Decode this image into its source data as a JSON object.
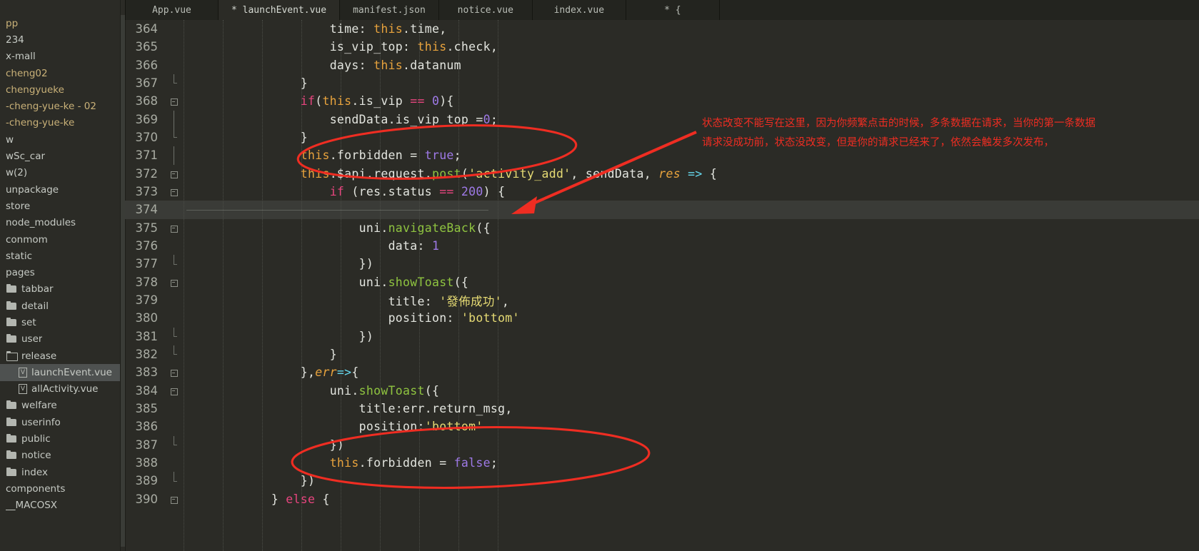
{
  "window": {
    "background": "#2b2b26",
    "annotation_color": "#ef2d22"
  },
  "sidebar": {
    "items": [
      {
        "label": "pp",
        "icon": "none",
        "color": "amber",
        "indent": 0,
        "selected": false
      },
      {
        "label": "234",
        "icon": "none",
        "color": "ltgray",
        "indent": 0,
        "selected": false
      },
      {
        "label": "x-mall",
        "icon": "none",
        "color": "ltgray",
        "indent": 0,
        "selected": false
      },
      {
        "label": "cheng02",
        "icon": "none",
        "color": "amber",
        "indent": 0,
        "selected": false
      },
      {
        "label": "chengyueke",
        "icon": "none",
        "color": "amber",
        "indent": 0,
        "selected": false
      },
      {
        "label": "-cheng-yue-ke - 02",
        "icon": "none",
        "color": "amber",
        "indent": 0,
        "selected": false
      },
      {
        "label": "-cheng-yue-ke",
        "icon": "none",
        "color": "amber",
        "indent": 0,
        "selected": false
      },
      {
        "label": "w",
        "icon": "none",
        "color": "ltgray",
        "indent": 0,
        "selected": false
      },
      {
        "label": "wSc_car",
        "icon": "none",
        "color": "ltgray",
        "indent": 0,
        "selected": false
      },
      {
        "label": "w(2)",
        "icon": "none",
        "color": "ltgray",
        "indent": 0,
        "selected": false
      },
      {
        "label": "unpackage",
        "icon": "none",
        "color": "ltgray",
        "indent": 0,
        "selected": false
      },
      {
        "label": "store",
        "icon": "none",
        "color": "ltgray",
        "indent": 0,
        "selected": false
      },
      {
        "label": "node_modules",
        "icon": "none",
        "color": "ltgray",
        "indent": 0,
        "selected": false
      },
      {
        "label": "conmom",
        "icon": "none",
        "color": "ltgray",
        "indent": 0,
        "selected": false
      },
      {
        "label": "static",
        "icon": "none",
        "color": "ltgray",
        "indent": 0,
        "selected": false
      },
      {
        "label": "pages",
        "icon": "none",
        "color": "ltgray",
        "indent": 0,
        "selected": false
      },
      {
        "label": "tabbar",
        "icon": "folder",
        "color": "ltgray",
        "indent": 0,
        "selected": false
      },
      {
        "label": "detail",
        "icon": "folder",
        "color": "ltgray",
        "indent": 0,
        "selected": false
      },
      {
        "label": "set",
        "icon": "folder",
        "color": "ltgray",
        "indent": 0,
        "selected": false
      },
      {
        "label": "user",
        "icon": "folder",
        "color": "ltgray",
        "indent": 0,
        "selected": false
      },
      {
        "label": "release",
        "icon": "folder-open",
        "color": "ltgray",
        "indent": 0,
        "selected": false
      },
      {
        "label": "launchEvent.vue",
        "icon": "vue-file",
        "color": "ltgray",
        "indent": 1,
        "selected": true
      },
      {
        "label": "allActivity.vue",
        "icon": "vue-file",
        "color": "ltgray",
        "indent": 1,
        "selected": false
      },
      {
        "label": "welfare",
        "icon": "folder",
        "color": "ltgray",
        "indent": 0,
        "selected": false
      },
      {
        "label": "userinfo",
        "icon": "folder",
        "color": "ltgray",
        "indent": 0,
        "selected": false
      },
      {
        "label": "public",
        "icon": "folder",
        "color": "ltgray",
        "indent": 0,
        "selected": false
      },
      {
        "label": "notice",
        "icon": "folder",
        "color": "ltgray",
        "indent": 0,
        "selected": false
      },
      {
        "label": "index",
        "icon": "folder",
        "color": "ltgray",
        "indent": 0,
        "selected": false
      },
      {
        "label": "components",
        "icon": "none",
        "color": "ltgray",
        "indent": 0,
        "selected": false
      },
      {
        "label": "__MACOSX",
        "icon": "none",
        "color": "ltgray",
        "indent": 0,
        "selected": false
      }
    ]
  },
  "tabs": [
    {
      "label": "App.vue",
      "active": false,
      "modified": false
    },
    {
      "label": "* launchEvent.vue",
      "active": true,
      "modified": true
    },
    {
      "label": "manifest.json",
      "active": false,
      "modified": false
    },
    {
      "label": "notice.vue",
      "active": false,
      "modified": false
    },
    {
      "label": "index.vue",
      "active": false,
      "modified": false
    },
    {
      "label": "* {",
      "active": false,
      "modified": true
    }
  ],
  "editor": {
    "first_line": 364,
    "current_line": 374,
    "lines": [
      {
        "num": "364",
        "fold": "none",
        "current": false,
        "tokens": [
          {
            "t": "                    ",
            "c": "plain"
          },
          {
            "t": "time",
            "c": "prop"
          },
          {
            "t": ": ",
            "c": "punct"
          },
          {
            "t": "this",
            "c": "this"
          },
          {
            "t": ".",
            "c": "punct"
          },
          {
            "t": "time",
            "c": "plain"
          },
          {
            "t": ",",
            "c": "punct"
          }
        ]
      },
      {
        "num": "365",
        "fold": "none",
        "current": false,
        "tokens": [
          {
            "t": "                    ",
            "c": "plain"
          },
          {
            "t": "is_vip_top",
            "c": "prop"
          },
          {
            "t": ": ",
            "c": "punct"
          },
          {
            "t": "this",
            "c": "this"
          },
          {
            "t": ".",
            "c": "punct"
          },
          {
            "t": "check",
            "c": "plain"
          },
          {
            "t": ",",
            "c": "punct"
          }
        ]
      },
      {
        "num": "366",
        "fold": "none",
        "current": false,
        "tokens": [
          {
            "t": "                    ",
            "c": "plain"
          },
          {
            "t": "days",
            "c": "prop"
          },
          {
            "t": ": ",
            "c": "punct"
          },
          {
            "t": "this",
            "c": "this"
          },
          {
            "t": ".",
            "c": "punct"
          },
          {
            "t": "datanum",
            "c": "plain"
          }
        ]
      },
      {
        "num": "367",
        "fold": "barend",
        "current": false,
        "tokens": [
          {
            "t": "                ",
            "c": "plain"
          },
          {
            "t": "}",
            "c": "punct"
          }
        ]
      },
      {
        "num": "368",
        "fold": "box",
        "current": false,
        "tokens": [
          {
            "t": "                ",
            "c": "plain"
          },
          {
            "t": "if",
            "c": "key"
          },
          {
            "t": "(",
            "c": "punct"
          },
          {
            "t": "this",
            "c": "this"
          },
          {
            "t": ".",
            "c": "punct"
          },
          {
            "t": "is_vip ",
            "c": "plain"
          },
          {
            "t": "==",
            "c": "key"
          },
          {
            "t": " ",
            "c": "plain"
          },
          {
            "t": "0",
            "c": "num"
          },
          {
            "t": "){",
            "c": "punct"
          }
        ]
      },
      {
        "num": "369",
        "fold": "bar",
        "current": false,
        "tokens": [
          {
            "t": "                    ",
            "c": "plain"
          },
          {
            "t": "sendData",
            "c": "plain"
          },
          {
            "t": ".",
            "c": "punct"
          },
          {
            "t": "is_vip_top =",
            "c": "plain"
          },
          {
            "t": "0",
            "c": "num"
          },
          {
            "t": ";",
            "c": "punct"
          }
        ]
      },
      {
        "num": "370",
        "fold": "barend",
        "current": false,
        "tokens": [
          {
            "t": "                ",
            "c": "plain"
          },
          {
            "t": "}",
            "c": "punct"
          }
        ]
      },
      {
        "num": "371",
        "fold": "bar",
        "current": false,
        "tokens": [
          {
            "t": "                ",
            "c": "plain"
          },
          {
            "t": "this",
            "c": "this"
          },
          {
            "t": ".",
            "c": "punct"
          },
          {
            "t": "forbidden ",
            "c": "plain"
          },
          {
            "t": "= ",
            "c": "punct"
          },
          {
            "t": "true",
            "c": "lit"
          },
          {
            "t": ";",
            "c": "punct"
          }
        ]
      },
      {
        "num": "372",
        "fold": "box",
        "current": false,
        "tokens": [
          {
            "t": "                ",
            "c": "plain"
          },
          {
            "t": "this",
            "c": "this"
          },
          {
            "t": ".",
            "c": "punct"
          },
          {
            "t": "$api",
            "c": "plain"
          },
          {
            "t": ".",
            "c": "punct"
          },
          {
            "t": "request",
            "c": "plain"
          },
          {
            "t": ".",
            "c": "punct"
          },
          {
            "t": "post",
            "c": "fn"
          },
          {
            "t": "(",
            "c": "punct"
          },
          {
            "t": "'activity_add'",
            "c": "str"
          },
          {
            "t": ", sendData, ",
            "c": "plain"
          },
          {
            "t": "res",
            "c": "param"
          },
          {
            "t": " ",
            "c": "plain"
          },
          {
            "t": "=>",
            "c": "arrow"
          },
          {
            "t": " {",
            "c": "punct"
          }
        ]
      },
      {
        "num": "373",
        "fold": "box",
        "current": false,
        "tokens": [
          {
            "t": "                    ",
            "c": "plain"
          },
          {
            "t": "if",
            "c": "key"
          },
          {
            "t": " (res",
            "c": "plain"
          },
          {
            "t": ".",
            "c": "punct"
          },
          {
            "t": "status ",
            "c": "plain"
          },
          {
            "t": "==",
            "c": "key"
          },
          {
            "t": " ",
            "c": "plain"
          },
          {
            "t": "200",
            "c": "num"
          },
          {
            "t": ") {",
            "c": "punct"
          }
        ]
      },
      {
        "num": "374",
        "fold": "none",
        "current": true,
        "tokens": [
          {
            "t": "",
            "c": "plain"
          }
        ]
      },
      {
        "num": "375",
        "fold": "box",
        "current": false,
        "tokens": [
          {
            "t": "                        ",
            "c": "plain"
          },
          {
            "t": "uni",
            "c": "plain"
          },
          {
            "t": ".",
            "c": "punct"
          },
          {
            "t": "navigateBack",
            "c": "fn"
          },
          {
            "t": "({",
            "c": "punct"
          }
        ]
      },
      {
        "num": "376",
        "fold": "none",
        "current": false,
        "tokens": [
          {
            "t": "                            ",
            "c": "plain"
          },
          {
            "t": "data",
            "c": "prop"
          },
          {
            "t": ": ",
            "c": "punct"
          },
          {
            "t": "1",
            "c": "num"
          }
        ]
      },
      {
        "num": "377",
        "fold": "barend",
        "current": false,
        "tokens": [
          {
            "t": "                        ",
            "c": "plain"
          },
          {
            "t": "})",
            "c": "punct"
          }
        ]
      },
      {
        "num": "378",
        "fold": "box",
        "current": false,
        "tokens": [
          {
            "t": "                        ",
            "c": "plain"
          },
          {
            "t": "uni",
            "c": "plain"
          },
          {
            "t": ".",
            "c": "punct"
          },
          {
            "t": "showToast",
            "c": "fn"
          },
          {
            "t": "({",
            "c": "punct"
          }
        ]
      },
      {
        "num": "379",
        "fold": "none",
        "current": false,
        "tokens": [
          {
            "t": "                            ",
            "c": "plain"
          },
          {
            "t": "title",
            "c": "prop"
          },
          {
            "t": ": ",
            "c": "punct"
          },
          {
            "t": "'發佈成功'",
            "c": "str"
          },
          {
            "t": ",",
            "c": "punct"
          }
        ]
      },
      {
        "num": "380",
        "fold": "none",
        "current": false,
        "tokens": [
          {
            "t": "                            ",
            "c": "plain"
          },
          {
            "t": "position",
            "c": "prop"
          },
          {
            "t": ": ",
            "c": "punct"
          },
          {
            "t": "'bottom'",
            "c": "str"
          }
        ]
      },
      {
        "num": "381",
        "fold": "barend",
        "current": false,
        "tokens": [
          {
            "t": "                        ",
            "c": "plain"
          },
          {
            "t": "})",
            "c": "punct"
          }
        ]
      },
      {
        "num": "382",
        "fold": "barend",
        "current": false,
        "tokens": [
          {
            "t": "                    ",
            "c": "plain"
          },
          {
            "t": "}",
            "c": "punct"
          }
        ]
      },
      {
        "num": "383",
        "fold": "box",
        "current": false,
        "tokens": [
          {
            "t": "                ",
            "c": "plain"
          },
          {
            "t": "},",
            "c": "punct"
          },
          {
            "t": "err",
            "c": "param"
          },
          {
            "t": "=>",
            "c": "arrow"
          },
          {
            "t": "{",
            "c": "punct"
          }
        ]
      },
      {
        "num": "384",
        "fold": "box",
        "current": false,
        "tokens": [
          {
            "t": "                    ",
            "c": "plain"
          },
          {
            "t": "uni",
            "c": "plain"
          },
          {
            "t": ".",
            "c": "punct"
          },
          {
            "t": "showToast",
            "c": "fn"
          },
          {
            "t": "({",
            "c": "punct"
          }
        ]
      },
      {
        "num": "385",
        "fold": "none",
        "current": false,
        "tokens": [
          {
            "t": "                        ",
            "c": "plain"
          },
          {
            "t": "title",
            "c": "prop"
          },
          {
            "t": ":err",
            "c": "plain"
          },
          {
            "t": ".",
            "c": "punct"
          },
          {
            "t": "return_msg",
            "c": "plain"
          },
          {
            "t": ",",
            "c": "punct"
          }
        ]
      },
      {
        "num": "386",
        "fold": "none",
        "current": false,
        "tokens": [
          {
            "t": "                        ",
            "c": "plain"
          },
          {
            "t": "position",
            "c": "prop"
          },
          {
            "t": ":",
            "c": "punct"
          },
          {
            "t": "'bottom'",
            "c": "str"
          }
        ]
      },
      {
        "num": "387",
        "fold": "barend",
        "current": false,
        "tokens": [
          {
            "t": "                    ",
            "c": "plain"
          },
          {
            "t": "})",
            "c": "punct"
          }
        ]
      },
      {
        "num": "388",
        "fold": "none",
        "current": false,
        "tokens": [
          {
            "t": "                    ",
            "c": "plain"
          },
          {
            "t": "this",
            "c": "this"
          },
          {
            "t": ".",
            "c": "punct"
          },
          {
            "t": "forbidden ",
            "c": "plain"
          },
          {
            "t": "= ",
            "c": "punct"
          },
          {
            "t": "false",
            "c": "lit"
          },
          {
            "t": ";",
            "c": "punct"
          }
        ]
      },
      {
        "num": "389",
        "fold": "barend",
        "current": false,
        "tokens": [
          {
            "t": "                ",
            "c": "plain"
          },
          {
            "t": "})",
            "c": "punct"
          }
        ]
      },
      {
        "num": "390",
        "fold": "box",
        "current": false,
        "tokens": [
          {
            "t": "            ",
            "c": "plain"
          },
          {
            "t": "} ",
            "c": "punct"
          },
          {
            "t": "else",
            "c": "key"
          },
          {
            "t": " {",
            "c": "punct"
          }
        ]
      }
    ]
  },
  "annotations": {
    "note": "状态改变不能写在这里，因为你频繁点击的时候，多条数据在请求，当你的第一条数据\n请求没成功前，状态没改变，但是你的请求已经来了，依然会触发多次发布，",
    "ellipse_top_label": "circles this.forbidden = true and post call",
    "ellipse_bottom_label": "circles this.forbidden = false block",
    "arrow_label": "arrow from note to line 374"
  }
}
